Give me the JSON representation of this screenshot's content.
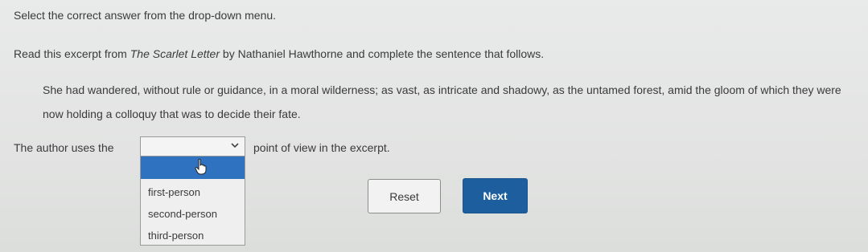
{
  "instruction": "Select the correct answer from the drop-down menu.",
  "prompt": {
    "before": "Read this excerpt from ",
    "title": "The Scarlet Letter",
    "after": " by Nathaniel Hawthorne and complete the sentence that follows."
  },
  "excerpt": "She had wandered, without rule or guidance, in a moral wilderness; as vast, as intricate and shadowy, as the untamed forest, amid the gloom of which they were now holding a colloquy that was to decide their fate.",
  "question": {
    "before": "The author uses the",
    "after": "point of view in the excerpt."
  },
  "dropdown": {
    "selected": "",
    "options": [
      "first-person",
      "second-person",
      "third-person"
    ],
    "highlight_color": "#2f73c0"
  },
  "buttons": {
    "reset": "Reset",
    "next": "Next",
    "next_color": "#1d5f9e"
  },
  "icons": {
    "select_arrow": "chevron-down-icon",
    "cursor": "hand-pointer-icon"
  }
}
